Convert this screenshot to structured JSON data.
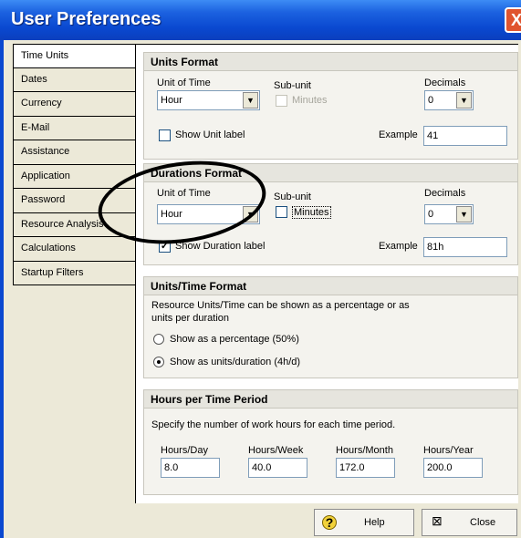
{
  "window": {
    "title": "User Preferences",
    "close_glyph": "X"
  },
  "tabs": [
    {
      "label": "Time Units",
      "selected": true
    },
    {
      "label": "Dates"
    },
    {
      "label": "Currency"
    },
    {
      "label": "E-Mail"
    },
    {
      "label": "Assistance"
    },
    {
      "label": "Application"
    },
    {
      "label": "Password"
    },
    {
      "label": "Resource Analysis"
    },
    {
      "label": "Calculations"
    },
    {
      "label": "Startup Filters"
    }
  ],
  "units_format": {
    "title": "Units Format",
    "unit_of_time_label": "Unit of Time",
    "unit_of_time_value": "Hour",
    "subunit_label": "Sub-unit",
    "subunit_checkbox_label": "Minutes",
    "decimals_label": "Decimals",
    "decimals_value": "0",
    "show_label_text": "Show Unit label",
    "show_label_checked": false,
    "example_label": "Example",
    "example_value": "41"
  },
  "durations_format": {
    "title": "Durations Format",
    "unit_of_time_label": "Unit of Time",
    "unit_of_time_value": "Hour",
    "subunit_label": "Sub-unit",
    "subunit_checkbox_label": "Minutes",
    "decimals_label": "Decimals",
    "decimals_value": "0",
    "show_label_text": "Show Duration label",
    "show_label_checked": true,
    "example_label": "Example",
    "example_value": "81h"
  },
  "units_time_format": {
    "title": "Units/Time Format",
    "description_line1": "Resource Units/Time can be shown as a percentage or as",
    "description_line2": "units per duration",
    "option_percentage": "Show as a percentage (50%)",
    "option_units": "Show as units/duration (4h/d)",
    "selected": "units"
  },
  "hours_per_period": {
    "title": "Hours per Time Period",
    "description": "Specify the number of work hours for each time period.",
    "fields": [
      {
        "label": "Hours/Day",
        "value": "8.0"
      },
      {
        "label": "Hours/Week",
        "value": "40.0"
      },
      {
        "label": "Hours/Month",
        "value": "172.0"
      },
      {
        "label": "Hours/Year",
        "value": "200.0"
      }
    ]
  },
  "buttons": {
    "help": "Help",
    "close": "Close"
  },
  "colors": {
    "title_bar": "#0a48d0",
    "highlight_ellipse": "#000000"
  }
}
